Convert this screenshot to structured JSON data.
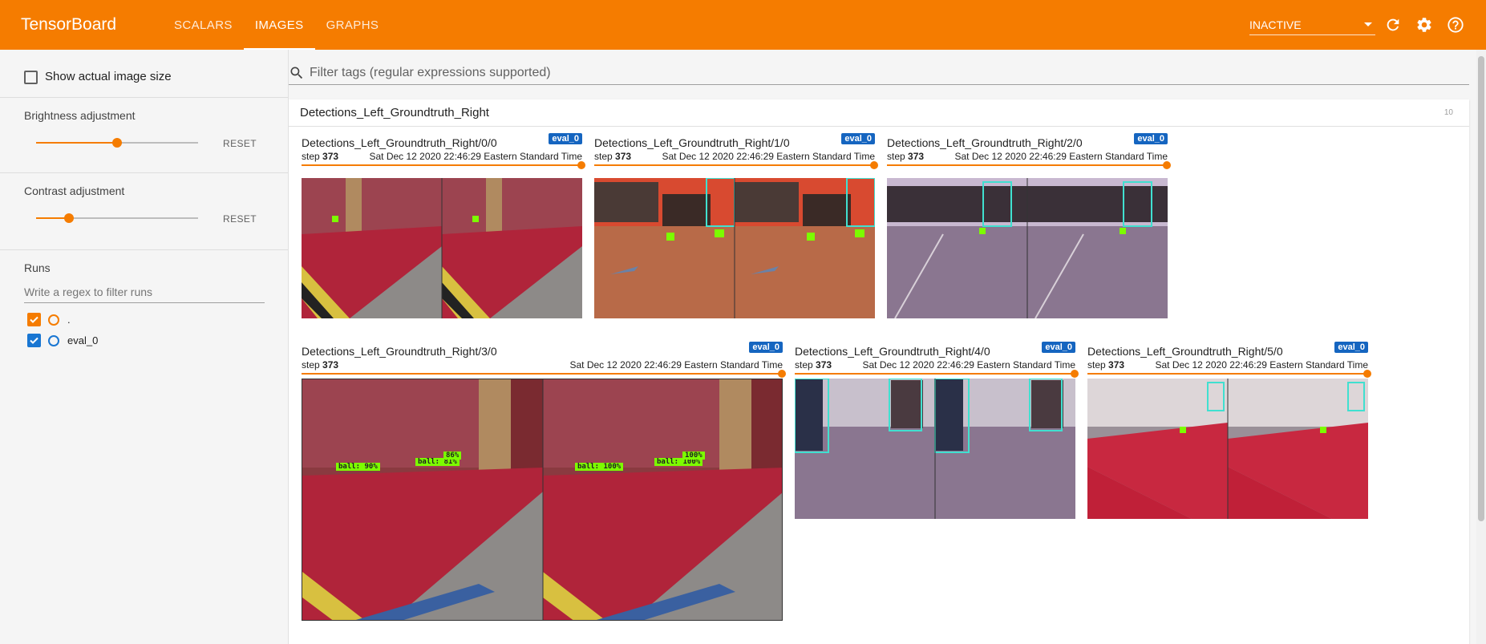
{
  "app": {
    "title": "TensorBoard"
  },
  "header": {
    "tabs": [
      {
        "label": "SCALARS",
        "active": false
      },
      {
        "label": "IMAGES",
        "active": true
      },
      {
        "label": "GRAPHS",
        "active": false
      }
    ],
    "run_select": "INACTIVE",
    "icons": [
      "refresh-icon",
      "settings-icon",
      "help-icon"
    ]
  },
  "sidebar": {
    "show_actual_size": {
      "label": "Show actual image size",
      "checked": false
    },
    "brightness": {
      "title": "Brightness adjustment",
      "reset": "RESET",
      "value": 0.5
    },
    "contrast": {
      "title": "Contrast adjustment",
      "reset": "RESET",
      "value": 0.2
    },
    "runs": {
      "title": "Runs",
      "placeholder": "Write a regex to filter runs",
      "items": [
        {
          "label": ".",
          "checked": true,
          "color": "#f57c00"
        },
        {
          "label": "eval_0",
          "checked": true,
          "color": "#1976d2"
        }
      ]
    }
  },
  "main": {
    "filter_placeholder": "Filter tags (regular expressions supported)",
    "group": {
      "title": "Detections_Left_Groundtruth_Right",
      "count": "10",
      "cards": [
        {
          "tag": "Detections_Left_Groundtruth_Right/0/0",
          "run": "eval_0",
          "step_label": "step",
          "step": "373",
          "time": "Sat Dec 12 2020 22:46:29 Eastern Standard Time",
          "scene": "hall"
        },
        {
          "tag": "Detections_Left_Groundtruth_Right/1/0",
          "run": "eval_0",
          "step_label": "step",
          "step": "373",
          "time": "Sat Dec 12 2020 22:46:29 Eastern Standard Time",
          "scene": "office"
        },
        {
          "tag": "Detections_Left_Groundtruth_Right/2/0",
          "run": "eval_0",
          "step_label": "step",
          "step": "373",
          "time": "Sat Dec 12 2020 22:46:29 Eastern Standard Time",
          "scene": "purple"
        },
        {
          "tag": "Detections_Left_Groundtruth_Right/3/0",
          "run": "eval_0",
          "step_label": "step",
          "step": "373",
          "time": "Sat Dec 12 2020 22:46:29 Eastern Standard Time",
          "scene": "hall"
        },
        {
          "tag": "Detections_Left_Groundtruth_Right/4/0",
          "run": "eval_0",
          "step_label": "step",
          "step": "373",
          "time": "Sat Dec 12 2020 22:46:29 Eastern Standard Time",
          "scene": "purple"
        },
        {
          "tag": "Detections_Left_Groundtruth_Right/5/0",
          "run": "eval_0",
          "step_label": "step",
          "step": "373",
          "time": "Sat Dec 12 2020 22:46:29 Eastern Standard Time",
          "scene": "room"
        }
      ],
      "detections_large": [
        "ball: 90%",
        "ball: 81%",
        "86%",
        "ball: 100%",
        "ball: 100%",
        "100%"
      ]
    }
  }
}
